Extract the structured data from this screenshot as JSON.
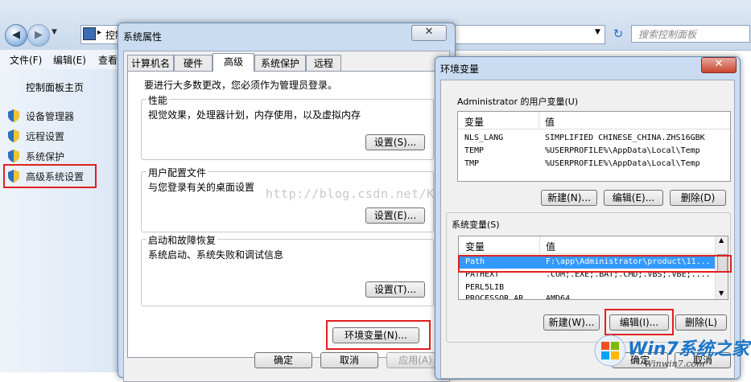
{
  "explorer": {
    "breadcrumb_root": "控制面",
    "search_placeholder": "搜索控制面板",
    "menu": [
      "文件(F)",
      "编辑(E)",
      "查看"
    ],
    "home_link": "控制面板主页",
    "tasks": [
      "设备管理器",
      "远程设置",
      "系统保护",
      "高级系统设置"
    ]
  },
  "sysprops": {
    "title": "系统属性",
    "tabs": [
      "计算机名",
      "硬件",
      "高级",
      "系统保护",
      "远程"
    ],
    "admin_note": "要进行大多数更改，您必须作为管理员登录。",
    "groups": [
      {
        "title": "性能",
        "desc": "视觉效果，处理器计划，内存使用，以及虚拟内存",
        "button": "设置(S)..."
      },
      {
        "title": "用户配置文件",
        "desc": "与您登录有关的桌面设置",
        "button": "设置(E)..."
      },
      {
        "title": "启动和故障恢复",
        "desc": "系统启动、系统失败和调试信息",
        "button": "设置(T)..."
      }
    ],
    "env_button": "环境变量(N)...",
    "ok": "确定",
    "cancel": "取消",
    "apply": "应用(A)"
  },
  "envvars": {
    "title": "环境变量",
    "user_section": "Administrator 的用户变量(U)",
    "col_var": "变量",
    "col_val": "值",
    "user_rows": [
      {
        "name": "NLS_LANG",
        "value": "SIMPLIFIED CHINESE_CHINA.ZHS16GBK"
      },
      {
        "name": "TEMP",
        "value": "%USERPROFILE%\\AppData\\Local\\Temp"
      },
      {
        "name": "TMP",
        "value": "%USERPROFILE%\\AppData\\Local\\Temp"
      }
    ],
    "user_buttons": [
      "新建(N)...",
      "编辑(E)...",
      "删除(D)"
    ],
    "system_section": "系统变量(S)",
    "system_rows": [
      {
        "name": "Path",
        "value": "F:\\app\\Administrator\\product\\11..."
      },
      {
        "name": "PATHEXT",
        "value": ".COM;.EXE;.BAT;.CMD;.VBS;.VBE;...."
      },
      {
        "name": "PERL5LIB",
        "value": ""
      },
      {
        "name": "PROCESSOR_AR...",
        "value": "AMD64"
      }
    ],
    "system_buttons": [
      "新建(W)...",
      "编辑(I)...",
      "删除(L)"
    ],
    "ok": "确定",
    "cancel": "取消"
  },
  "watermark": "http://blog.csdn.net/Kevin_LiuYM",
  "logo": {
    "text": "Win7系统之家",
    "url": "Winwin7.com"
  },
  "colors": {
    "highlight": "#e02020",
    "selection": "#3399ff",
    "accent": "#1a74c8"
  }
}
